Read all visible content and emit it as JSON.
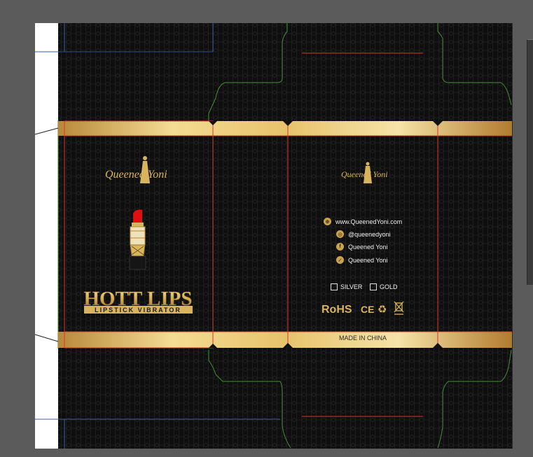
{
  "package": {
    "logo_text": "Queened Yoni",
    "product_name": "HOTT LIPS",
    "product_subtitle": "LIPSTICK VIBRATOR",
    "made_in": "MADE IN CHINA",
    "social": [
      {
        "icon": "globe-icon",
        "glyph": "⊕",
        "text": "www.QueenedYoni.com"
      },
      {
        "icon": "instagram-icon",
        "glyph": "◎",
        "text": "@queenedyoni"
      },
      {
        "icon": "facebook-icon",
        "glyph": "f",
        "text": "Queened Yoni"
      },
      {
        "icon": "twitter-icon",
        "glyph": "✓",
        "text": "Queened Yoni"
      }
    ],
    "options": [
      {
        "label": "SILVER",
        "checked": false
      },
      {
        "label": "GOLD",
        "checked": false
      }
    ],
    "certifications": {
      "rohs": "RoHS",
      "ce": "CE",
      "recycle_glyph": "♻",
      "weee_glyph": "🗑"
    }
  },
  "colors": {
    "workspace_bg": "#5b5b5b",
    "box_bg": "#101010",
    "gold": "#d9b45e",
    "cut_line": "#d23a2a",
    "fold_line": "#4a8a3a",
    "guide_line": "#3b5bb0",
    "lipstick_red": "#e01010"
  }
}
